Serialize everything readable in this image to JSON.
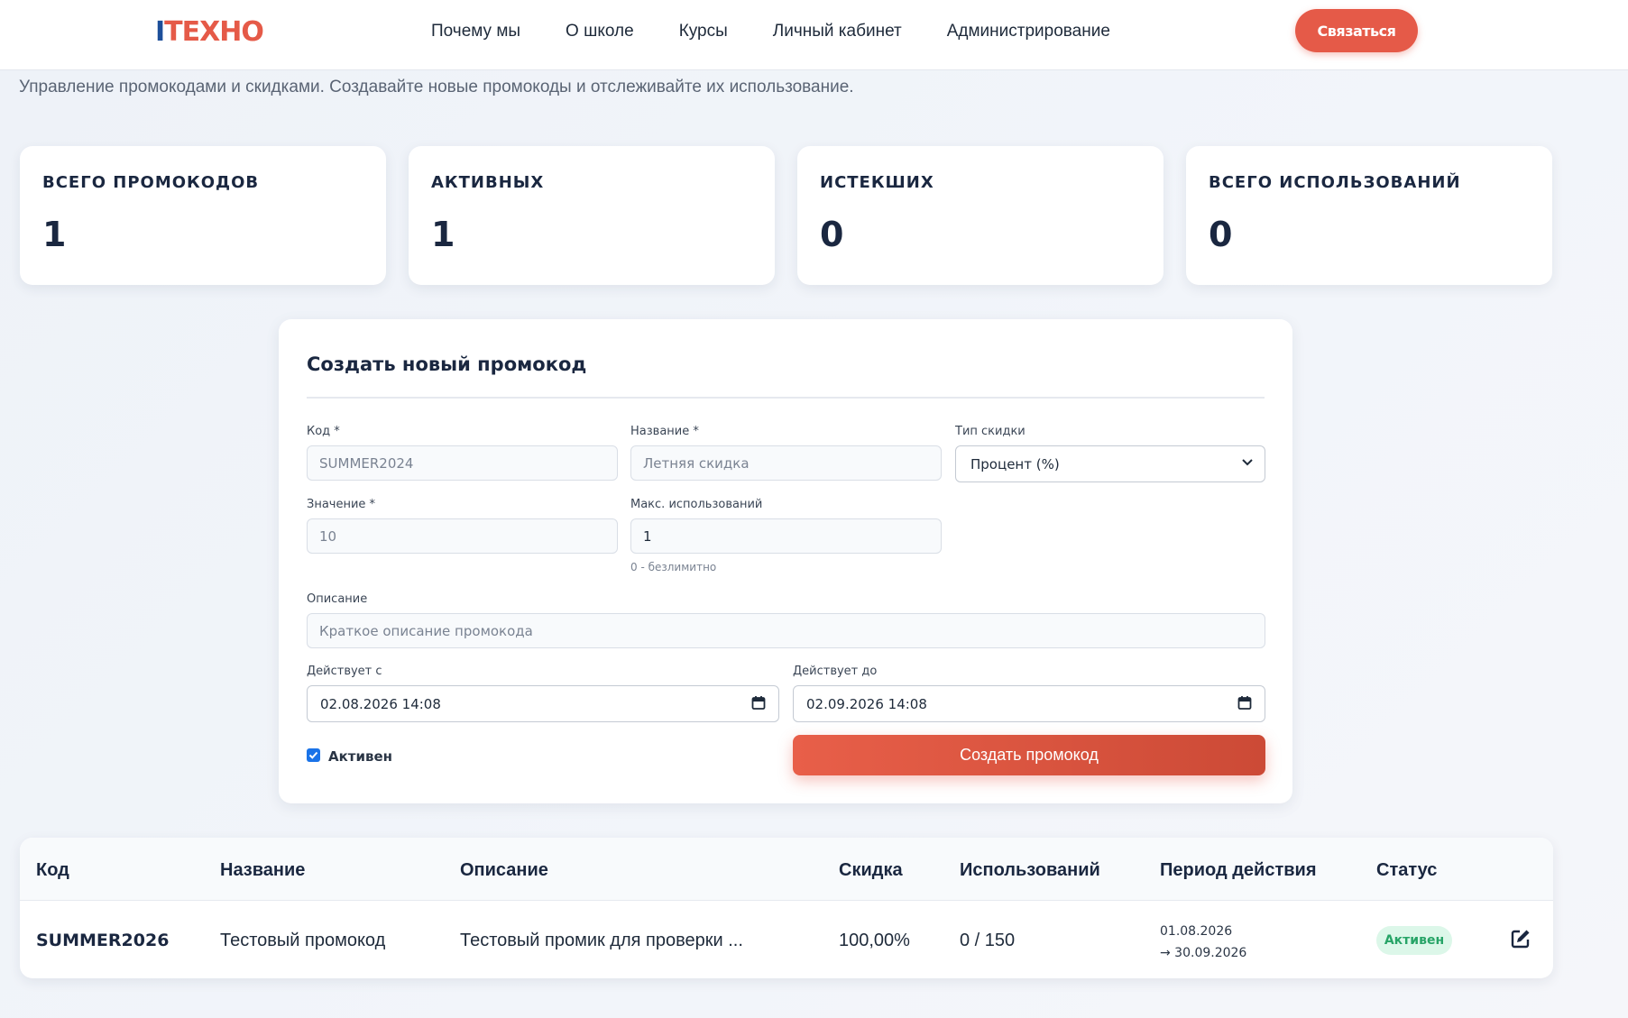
{
  "header": {
    "logo_part1": "I",
    "logo_part2": "ТЕХНО",
    "nav": [
      "Почему мы",
      "О школе",
      "Курсы",
      "Личный кабинет",
      "Администрирование"
    ],
    "contact_label": "Связаться"
  },
  "subtitle": "Управление промокодами и скидками. Создавайте новые промокоды и отслеживайте их использование.",
  "stats": [
    {
      "label": "Всего промокодов",
      "value": "1"
    },
    {
      "label": "Активных",
      "value": "1"
    },
    {
      "label": "Истекших",
      "value": "0"
    },
    {
      "label": "Всего использований",
      "value": "0"
    }
  ],
  "form": {
    "title": "Создать новый промокод",
    "code_label": "Код *",
    "code_placeholder": "SUMMER2024",
    "name_label": "Название *",
    "name_placeholder": "Летняя скидка",
    "type_label": "Тип скидки",
    "type_value": "Процент (%)",
    "value_label": "Значение *",
    "value_placeholder": "10",
    "max_label": "Макс. использований",
    "max_value": "1",
    "max_hint": "0 - безлимитно",
    "desc_label": "Описание",
    "desc_placeholder": "Краткое описание промокода",
    "from_label": "Действует с",
    "from_value": "02.08.2026 14:08",
    "to_label": "Действует до",
    "to_value": "02.09.2026 14:08",
    "active_label": "Активен",
    "active_checked": true,
    "submit_label": "Создать промокод"
  },
  "table": {
    "headers": [
      "Код",
      "Название",
      "Описание",
      "Скидка",
      "Использований",
      "Период действия",
      "Статус"
    ],
    "rows": [
      {
        "code": "SUMMER2026",
        "name": "Тестовый промокод",
        "description": "Тестовый промик для проверки ...",
        "discount": "100,00%",
        "usage": "0 / 150",
        "period_from": "01.08.2026",
        "period_to": "→ 30.09.2026",
        "status": "Активен"
      }
    ]
  },
  "colors": {
    "accent": "#e55a48",
    "brand_blue": "#1d4f9a",
    "status_active_bg": "#dcf7e9",
    "status_active_text": "#27a467"
  }
}
